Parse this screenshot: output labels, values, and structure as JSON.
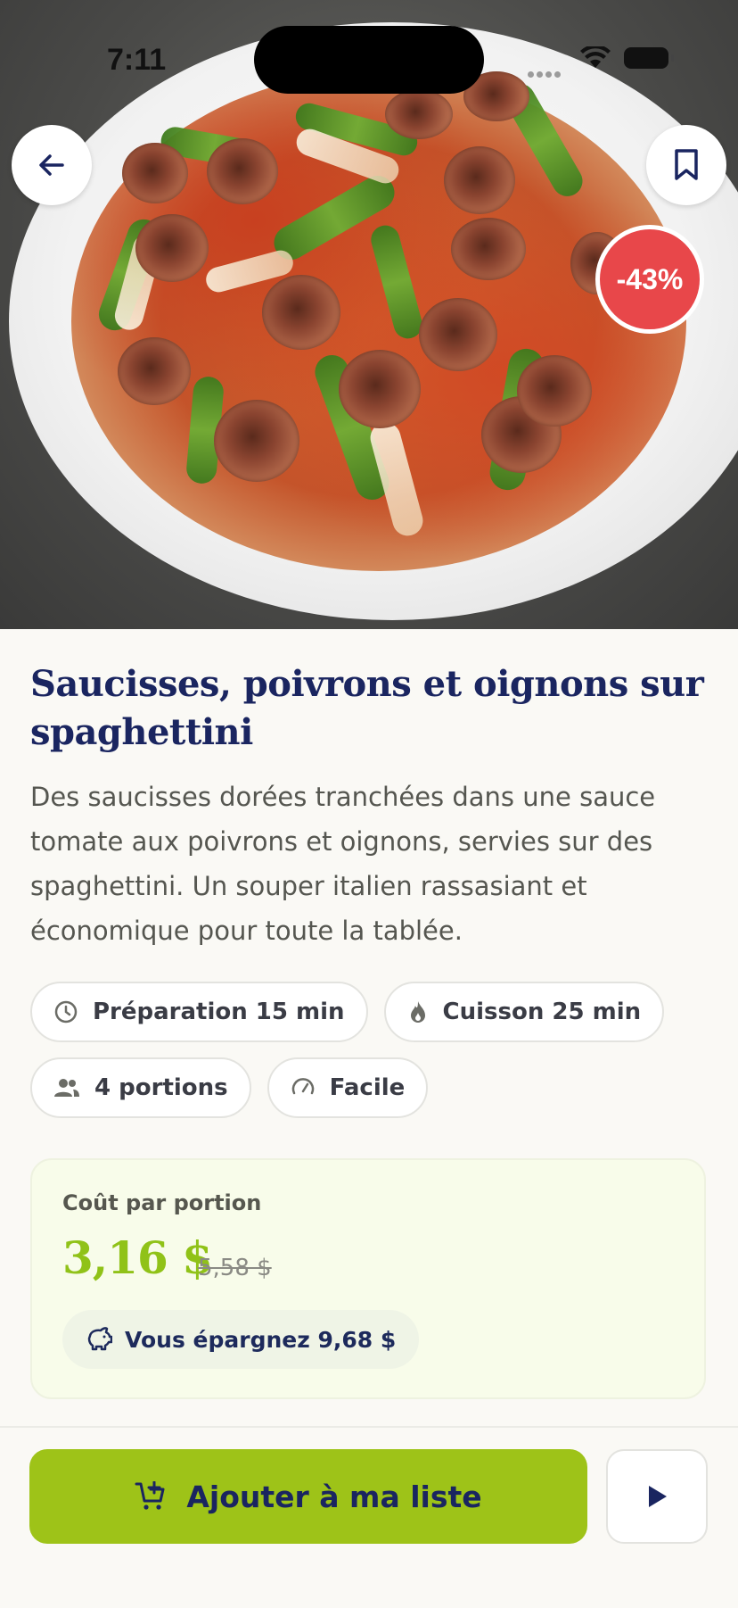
{
  "status_bar": {
    "time": "7:11"
  },
  "hero": {
    "discount_badge": "-43%",
    "back_icon": "arrow-left-icon",
    "bookmark_icon": "bookmark-icon"
  },
  "recipe": {
    "title": "Saucisses, poivrons et oignons sur spaghettini",
    "description": "Des saucisses dorées tranchées dans une sauce tomate aux poivrons et oignons, servies sur des spaghettini. Un souper italien rassasiant et économique pour toute la tablée."
  },
  "chips": [
    {
      "icon": "clock-icon",
      "label": "Préparation 15 min"
    },
    {
      "icon": "flame-icon",
      "label": "Cuisson 25 min"
    },
    {
      "icon": "people-icon",
      "label": "4 portions"
    },
    {
      "icon": "gauge-icon",
      "label": "Facile"
    }
  ],
  "cost": {
    "label": "Coût par portion",
    "price": "3,16 $",
    "old_price": "5,58 $",
    "savings": "Vous épargnez 9,68 $"
  },
  "actions": {
    "add_to_list": "Ajouter à ma liste",
    "play_icon": "play-icon"
  },
  "colors": {
    "navy": "#1a2560",
    "lime": "#9ec318",
    "badge_red": "#e8474a",
    "background": "#faf9f5"
  }
}
